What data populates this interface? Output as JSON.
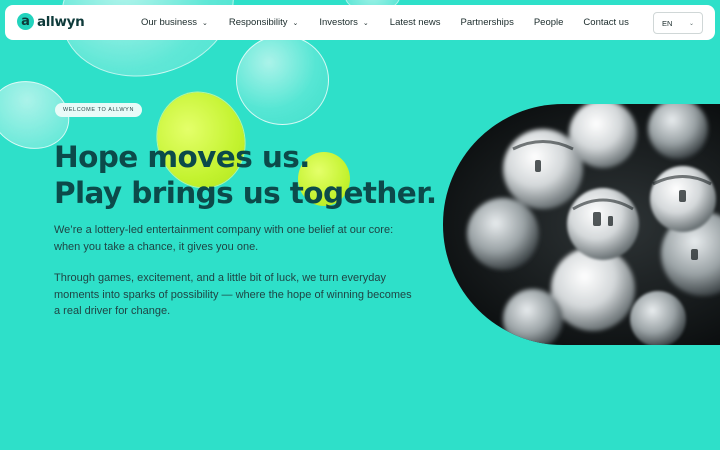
{
  "brand": {
    "logo_mark": "a",
    "name": "allwyn"
  },
  "nav": {
    "items": [
      {
        "label": "Our business",
        "dropdown": true
      },
      {
        "label": "Responsibility",
        "dropdown": true
      },
      {
        "label": "Investors",
        "dropdown": true
      },
      {
        "label": "Latest news",
        "dropdown": false
      },
      {
        "label": "Partnerships",
        "dropdown": false
      },
      {
        "label": "People",
        "dropdown": false
      },
      {
        "label": "Contact us",
        "dropdown": false
      }
    ],
    "language": "EN",
    "chevron": "⌄"
  },
  "hero": {
    "badge": "WELCOME TO ALLWYN",
    "headline_line1": "Hope moves us.",
    "headline_line2": "Play brings us together.",
    "paragraph1": "We’re a lottery-led entertainment company with one belief at our core: when you take a chance, it gives you one.",
    "paragraph2": "Through games, excitement, and a little bit of luck, we turn everyday moments into sparks of possibility — where the hope of winning becomes a real driver for change.",
    "image_subject": "lottery balls in motion"
  },
  "colors": {
    "background": "#2ee0c9",
    "headline": "#0c4a4a",
    "accent_lime": "#c4f330",
    "nav_bg": "#ffffff"
  }
}
